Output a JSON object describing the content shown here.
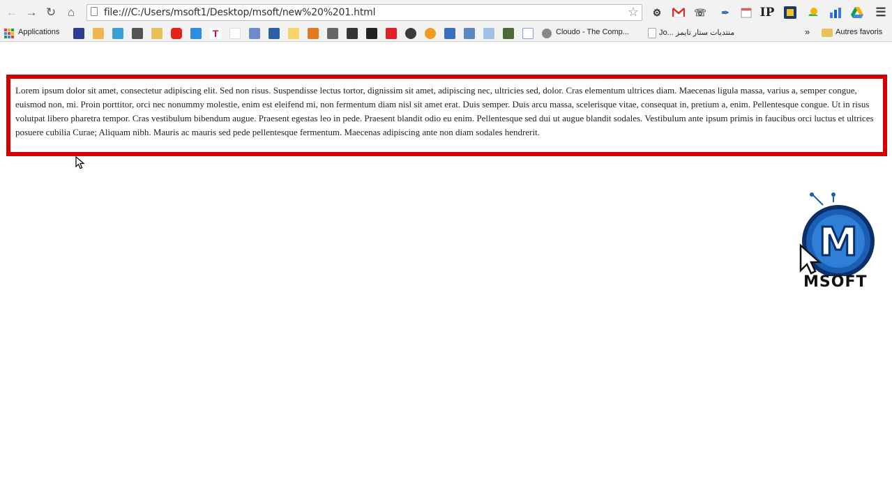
{
  "browser": {
    "url": "file:///C:/Users/msoft1/Desktop/msoft/new%20%201.html",
    "extensions": [
      "settings-icon",
      "gmail-icon",
      "phone-icon",
      "wrench-icon",
      "calendar-icon",
      "IP",
      "extension-icon",
      "weather-icon",
      "chart-icon",
      "drive-icon",
      "menu-icon"
    ],
    "ip_label": "IP"
  },
  "bookmarks": {
    "apps_label": "Applications",
    "cloudo_label": "Cloudo - The Comp...",
    "arabic_label": "منتديات ستار تايمز ...Jo",
    "other_label": "Autres favoris",
    "overflow_label": "»"
  },
  "page": {
    "lorem": "Lorem ipsum dolor sit amet, consectetur adipiscing elit. Sed non risus. Suspendisse lectus tortor, dignissim sit amet, adipiscing nec, ultricies sed, dolor. Cras elementum ultrices diam. Maecenas ligula massa, varius a, semper congue, euismod non, mi. Proin porttitor, orci nec nonummy molestie, enim est eleifend mi, non fermentum diam nisl sit amet erat. Duis semper. Duis arcu massa, scelerisque vitae, consequat in, pretium a, enim. Pellentesque congue. Ut in risus volutpat libero pharetra tempor. Cras vestibulum bibendum augue. Praesent egestas leo in pede. Praesent blandit odio eu enim. Pellentesque sed dui ut augue blandit sodales. Vestibulum ante ipsum primis in faucibus orci luctus et ultrices posuere cubilia Curae; Aliquam nibh. Mauris ac mauris sed pede pellentesque fermentum. Maecenas adipiscing ante non diam sodales hendrerit.",
    "box_border_color": "#d10000"
  },
  "logo": {
    "text": "MSOFT",
    "letter": "M",
    "color": "#1a5fb4"
  }
}
